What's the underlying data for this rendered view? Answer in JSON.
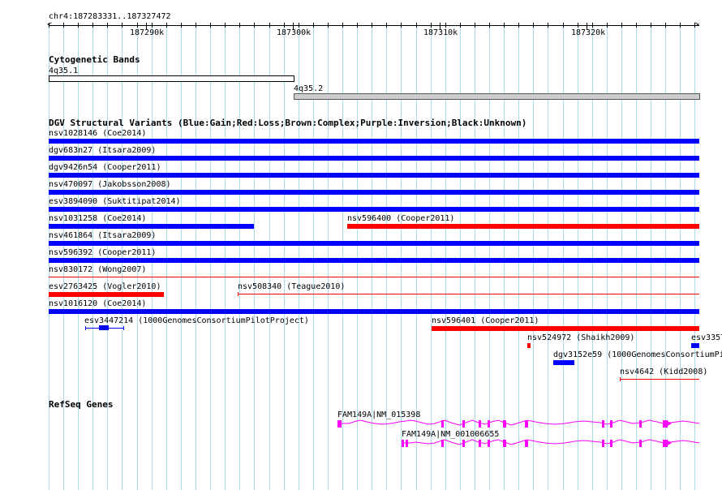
{
  "ruler": {
    "coordinate_label": "chr4:187283331..187327472",
    "major_labels": [
      "187290k",
      "187300k",
      "187310k",
      "187320k"
    ]
  },
  "cytoband": {
    "section_title": "Cytogenetic Bands",
    "band1_label": "4q35.1",
    "band2_label": "4q35.2",
    "band2_color": "#cccccc"
  },
  "dgv": {
    "section_title": "DGV Structural Variants (Blue:Gain;Red:Loss;Brown:Complex;Purple:Inversion;Black:Unknown)",
    "colors": {
      "gain": "#0000ff",
      "loss": "#ff0000"
    },
    "labels": {
      "nsv1028146": "nsv1028146 (Coe2014)",
      "dgv683n27": "dgv683n27 (Itsara2009)",
      "dgv9426n54": "dgv9426n54 (Cooper2011)",
      "nsv470097": "nsv470097 (Jakobsson2008)",
      "esv3894090": "esv3894090 (Suktitipat2014)",
      "nsv1031258": "nsv1031258 (Coe2014)",
      "nsv596400": "nsv596400 (Cooper2011)",
      "nsv461864": "nsv461864 (Itsara2009)",
      "nsv596392": "nsv596392 (Cooper2011)",
      "nsv830172": "nsv830172 (Wong2007)",
      "esv2763425": "esv2763425 (Vogler2010)",
      "nsv508340": "nsv508340 (Teague2010)",
      "nsv1016120": "nsv1016120 (Coe2014)",
      "esv3447214": "esv3447214 (1000GenomesConsortiumPilotProject)",
      "nsv596401": "nsv596401 (Cooper2011)",
      "nsv524972": "nsv524972 (Shaikh2009)",
      "esv3357": "esv3357",
      "dgv3152e59": "dgv3152e59 (1000GenomesConsortiumPi",
      "nsv4642": "nsv4642 (Kidd2008)"
    }
  },
  "refseq": {
    "section_title": "RefSeq Genes",
    "gene_color": "#ff00ff",
    "transcript1_label": "FAM149A|NM_015398",
    "transcript2_label": "FAM149A|NM_001006655"
  }
}
